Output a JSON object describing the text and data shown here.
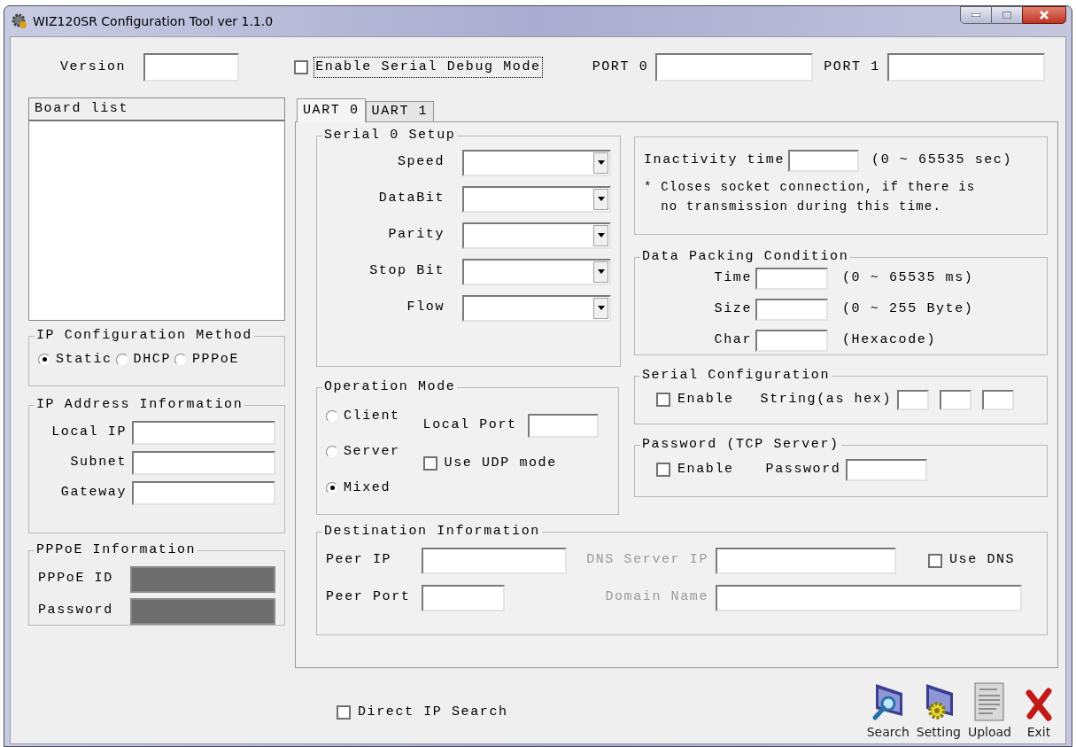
{
  "window": {
    "title": "WIZ120SR Configuration Tool ver 1.1.0"
  },
  "top_bar": {
    "version_label": "Version",
    "debug": {
      "label": "Enable Serial Debug Mode",
      "checked": false
    },
    "ports": [
      {
        "label": "PORT 0"
      },
      {
        "label": "PORT 1"
      }
    ]
  },
  "board_list": {
    "heading": "Board list"
  },
  "ip_method": {
    "title": "IP Configuration Method",
    "options": [
      {
        "label": "Static",
        "selected": true
      },
      {
        "label": "DHCP",
        "selected": false
      },
      {
        "label": "PPPoE",
        "selected": false
      }
    ]
  },
  "ip_address": {
    "title": "IP Address Information",
    "fields": [
      {
        "label": "Local IP"
      },
      {
        "label": "Subnet"
      },
      {
        "label": "Gateway"
      }
    ]
  },
  "pppoe": {
    "title": "PPPoE Information",
    "fields": [
      {
        "label": "PPPoE ID",
        "disabled": true
      },
      {
        "label": "Password",
        "disabled": true
      }
    ]
  },
  "tabs": [
    {
      "label": "UART 0",
      "selected": true
    },
    {
      "label": "UART 1",
      "selected": false
    }
  ],
  "serial_setup": {
    "title": "Serial 0 Setup",
    "fields": [
      {
        "label": "Speed"
      },
      {
        "label": "DataBit"
      },
      {
        "label": "Parity"
      },
      {
        "label": "Stop Bit"
      },
      {
        "label": "Flow"
      }
    ]
  },
  "inactivity": {
    "label": "Inactivity time",
    "range": "(0 ~ 65535 sec)",
    "note_lines": [
      "* Closes socket connection, if there is",
      "  no transmission during this time."
    ]
  },
  "data_packing": {
    "title": "Data Packing Condition",
    "fields": [
      {
        "label": "Time",
        "hint": "(0 ~ 65535 ms)"
      },
      {
        "label": "Size",
        "hint": "(0 ~ 255 Byte)"
      },
      {
        "label": "Char",
        "hint": "(Hexacode)"
      }
    ]
  },
  "operation_mode": {
    "title": "Operation Mode",
    "options": [
      {
        "label": "Client",
        "selected": false
      },
      {
        "label": "Server",
        "selected": false
      },
      {
        "label": "Mixed",
        "selected": true
      }
    ],
    "local_port_label": "Local Port",
    "udp": {
      "label": "Use UDP mode",
      "checked": false
    }
  },
  "serial_config": {
    "title": "Serial Configuration",
    "enable": {
      "label": "Enable",
      "checked": false
    },
    "string_label": "String(as hex)"
  },
  "password": {
    "title": "Password (TCP Server)",
    "enable": {
      "label": "Enable",
      "checked": false
    },
    "password_label": "Password"
  },
  "destination": {
    "title": "Destination Information",
    "peer_ip": {
      "label": "Peer IP",
      "disabled": false
    },
    "dns_server_ip": {
      "label": "DNS Server IP",
      "disabled": true
    },
    "use_dns": {
      "label": "Use DNS",
      "checked": false
    },
    "peer_port": {
      "label": "Peer Port",
      "disabled": false
    },
    "domain_name": {
      "label": "Domain Name",
      "disabled": true
    }
  },
  "direct_ip_search": {
    "label": "Direct IP Search",
    "checked": false
  },
  "toolbar": [
    {
      "label": "Search",
      "kind": "search"
    },
    {
      "label": "Setting",
      "kind": "setting"
    },
    {
      "label": "Upload",
      "kind": "upload"
    },
    {
      "label": "Exit",
      "kind": "exit"
    }
  ]
}
